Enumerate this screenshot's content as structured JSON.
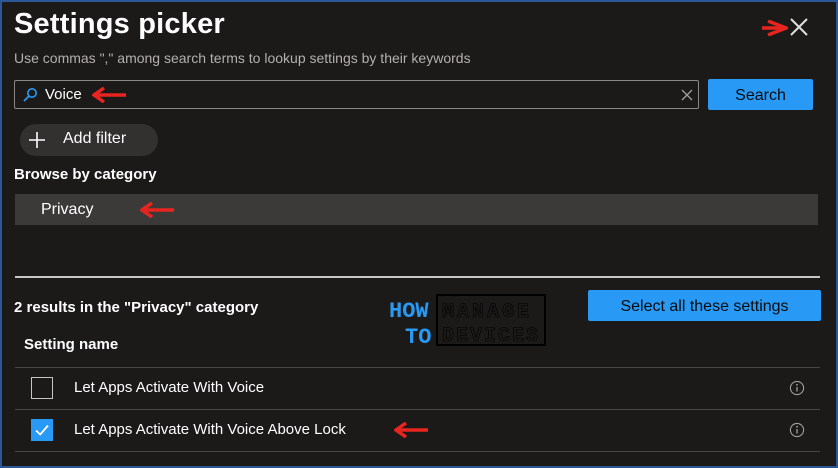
{
  "dialog": {
    "title": "Settings picker",
    "subtitle": "Use commas \",\" among search terms to lookup settings by their keywords"
  },
  "search": {
    "value": "Voice",
    "placeholder": "",
    "button_label": "Search"
  },
  "filter": {
    "add_label": "Add filter"
  },
  "browse": {
    "heading": "Browse by category",
    "categories": [
      {
        "label": "Privacy",
        "selected": true
      }
    ]
  },
  "results": {
    "summary": "2 results in the \"Privacy\" category",
    "select_all_label": "Select all these settings",
    "column_header": "Setting name",
    "rows": [
      {
        "name": "Let Apps Activate With Voice",
        "checked": false
      },
      {
        "name": "Let Apps Activate With Voice Above Lock",
        "checked": true
      }
    ]
  },
  "watermark": {
    "line1": "HOW",
    "line2": "TO",
    "word1": "MANAGE",
    "word2": "DEVICES"
  },
  "colors": {
    "accent": "#2899f5",
    "annotation_arrow": "#e8241f",
    "background": "#1b1a19",
    "border": "#2b5797"
  },
  "icons": [
    "close-icon",
    "search-icon",
    "clear-icon",
    "plus-icon",
    "checkmark-icon",
    "info-icon",
    "annotation-arrow-icon"
  ]
}
